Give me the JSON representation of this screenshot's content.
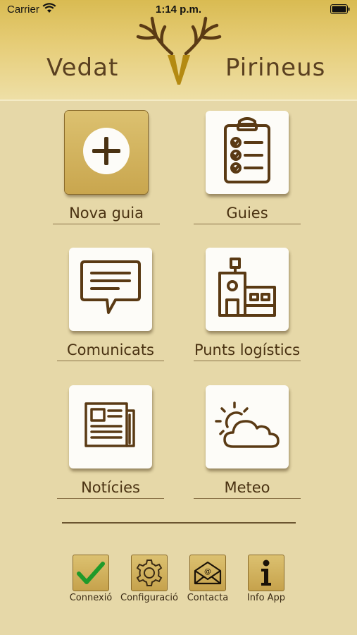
{
  "status_bar": {
    "carrier": "Carrier",
    "time": "1:14 p.m."
  },
  "header": {
    "brand_left": "Vedat",
    "brand_right": "Pirineus",
    "logo_icon": "deer-antlers-v-logo-icon"
  },
  "colors": {
    "gold": "#c9a64e",
    "brown": "#5a3a14",
    "background": "#e6d8a8",
    "check_green": "#1f9a2a"
  },
  "menu": [
    {
      "label": "Nova guia",
      "icon": "plus-circle-icon",
      "selected": true
    },
    {
      "label": "Guies",
      "icon": "clipboard-checklist-icon"
    },
    {
      "label": "Comunicats",
      "icon": "speech-bubble-icon"
    },
    {
      "label": "Punts logístics",
      "icon": "buildings-icon"
    },
    {
      "label": "Notícies",
      "icon": "newspaper-icon"
    },
    {
      "label": "Meteo",
      "icon": "sun-cloud-icon"
    }
  ],
  "bottom_nav": [
    {
      "label": "Connexió",
      "icon": "checkmark-icon"
    },
    {
      "label": "Configuració",
      "icon": "gear-icon"
    },
    {
      "label": "Contacta",
      "icon": "envelope-at-icon"
    },
    {
      "label": "Info App",
      "icon": "info-icon"
    }
  ]
}
